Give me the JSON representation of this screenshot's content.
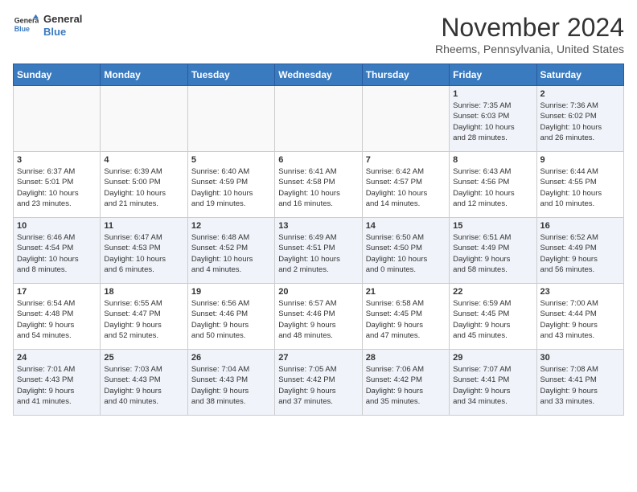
{
  "logo": {
    "line1": "General",
    "line2": "Blue"
  },
  "title": "November 2024",
  "subtitle": "Rheems, Pennsylvania, United States",
  "days_of_week": [
    "Sunday",
    "Monday",
    "Tuesday",
    "Wednesday",
    "Thursday",
    "Friday",
    "Saturday"
  ],
  "weeks": [
    [
      {
        "day": "",
        "info": ""
      },
      {
        "day": "",
        "info": ""
      },
      {
        "day": "",
        "info": ""
      },
      {
        "day": "",
        "info": ""
      },
      {
        "day": "",
        "info": ""
      },
      {
        "day": "1",
        "info": "Sunrise: 7:35 AM\nSunset: 6:03 PM\nDaylight: 10 hours\nand 28 minutes."
      },
      {
        "day": "2",
        "info": "Sunrise: 7:36 AM\nSunset: 6:02 PM\nDaylight: 10 hours\nand 26 minutes."
      }
    ],
    [
      {
        "day": "3",
        "info": "Sunrise: 6:37 AM\nSunset: 5:01 PM\nDaylight: 10 hours\nand 23 minutes."
      },
      {
        "day": "4",
        "info": "Sunrise: 6:39 AM\nSunset: 5:00 PM\nDaylight: 10 hours\nand 21 minutes."
      },
      {
        "day": "5",
        "info": "Sunrise: 6:40 AM\nSunset: 4:59 PM\nDaylight: 10 hours\nand 19 minutes."
      },
      {
        "day": "6",
        "info": "Sunrise: 6:41 AM\nSunset: 4:58 PM\nDaylight: 10 hours\nand 16 minutes."
      },
      {
        "day": "7",
        "info": "Sunrise: 6:42 AM\nSunset: 4:57 PM\nDaylight: 10 hours\nand 14 minutes."
      },
      {
        "day": "8",
        "info": "Sunrise: 6:43 AM\nSunset: 4:56 PM\nDaylight: 10 hours\nand 12 minutes."
      },
      {
        "day": "9",
        "info": "Sunrise: 6:44 AM\nSunset: 4:55 PM\nDaylight: 10 hours\nand 10 minutes."
      }
    ],
    [
      {
        "day": "10",
        "info": "Sunrise: 6:46 AM\nSunset: 4:54 PM\nDaylight: 10 hours\nand 8 minutes."
      },
      {
        "day": "11",
        "info": "Sunrise: 6:47 AM\nSunset: 4:53 PM\nDaylight: 10 hours\nand 6 minutes."
      },
      {
        "day": "12",
        "info": "Sunrise: 6:48 AM\nSunset: 4:52 PM\nDaylight: 10 hours\nand 4 minutes."
      },
      {
        "day": "13",
        "info": "Sunrise: 6:49 AM\nSunset: 4:51 PM\nDaylight: 10 hours\nand 2 minutes."
      },
      {
        "day": "14",
        "info": "Sunrise: 6:50 AM\nSunset: 4:50 PM\nDaylight: 10 hours\nand 0 minutes."
      },
      {
        "day": "15",
        "info": "Sunrise: 6:51 AM\nSunset: 4:49 PM\nDaylight: 9 hours\nand 58 minutes."
      },
      {
        "day": "16",
        "info": "Sunrise: 6:52 AM\nSunset: 4:49 PM\nDaylight: 9 hours\nand 56 minutes."
      }
    ],
    [
      {
        "day": "17",
        "info": "Sunrise: 6:54 AM\nSunset: 4:48 PM\nDaylight: 9 hours\nand 54 minutes."
      },
      {
        "day": "18",
        "info": "Sunrise: 6:55 AM\nSunset: 4:47 PM\nDaylight: 9 hours\nand 52 minutes."
      },
      {
        "day": "19",
        "info": "Sunrise: 6:56 AM\nSunset: 4:46 PM\nDaylight: 9 hours\nand 50 minutes."
      },
      {
        "day": "20",
        "info": "Sunrise: 6:57 AM\nSunset: 4:46 PM\nDaylight: 9 hours\nand 48 minutes."
      },
      {
        "day": "21",
        "info": "Sunrise: 6:58 AM\nSunset: 4:45 PM\nDaylight: 9 hours\nand 47 minutes."
      },
      {
        "day": "22",
        "info": "Sunrise: 6:59 AM\nSunset: 4:45 PM\nDaylight: 9 hours\nand 45 minutes."
      },
      {
        "day": "23",
        "info": "Sunrise: 7:00 AM\nSunset: 4:44 PM\nDaylight: 9 hours\nand 43 minutes."
      }
    ],
    [
      {
        "day": "24",
        "info": "Sunrise: 7:01 AM\nSunset: 4:43 PM\nDaylight: 9 hours\nand 41 minutes."
      },
      {
        "day": "25",
        "info": "Sunrise: 7:03 AM\nSunset: 4:43 PM\nDaylight: 9 hours\nand 40 minutes."
      },
      {
        "day": "26",
        "info": "Sunrise: 7:04 AM\nSunset: 4:43 PM\nDaylight: 9 hours\nand 38 minutes."
      },
      {
        "day": "27",
        "info": "Sunrise: 7:05 AM\nSunset: 4:42 PM\nDaylight: 9 hours\nand 37 minutes."
      },
      {
        "day": "28",
        "info": "Sunrise: 7:06 AM\nSunset: 4:42 PM\nDaylight: 9 hours\nand 35 minutes."
      },
      {
        "day": "29",
        "info": "Sunrise: 7:07 AM\nSunset: 4:41 PM\nDaylight: 9 hours\nand 34 minutes."
      },
      {
        "day": "30",
        "info": "Sunrise: 7:08 AM\nSunset: 4:41 PM\nDaylight: 9 hours\nand 33 minutes."
      }
    ]
  ]
}
